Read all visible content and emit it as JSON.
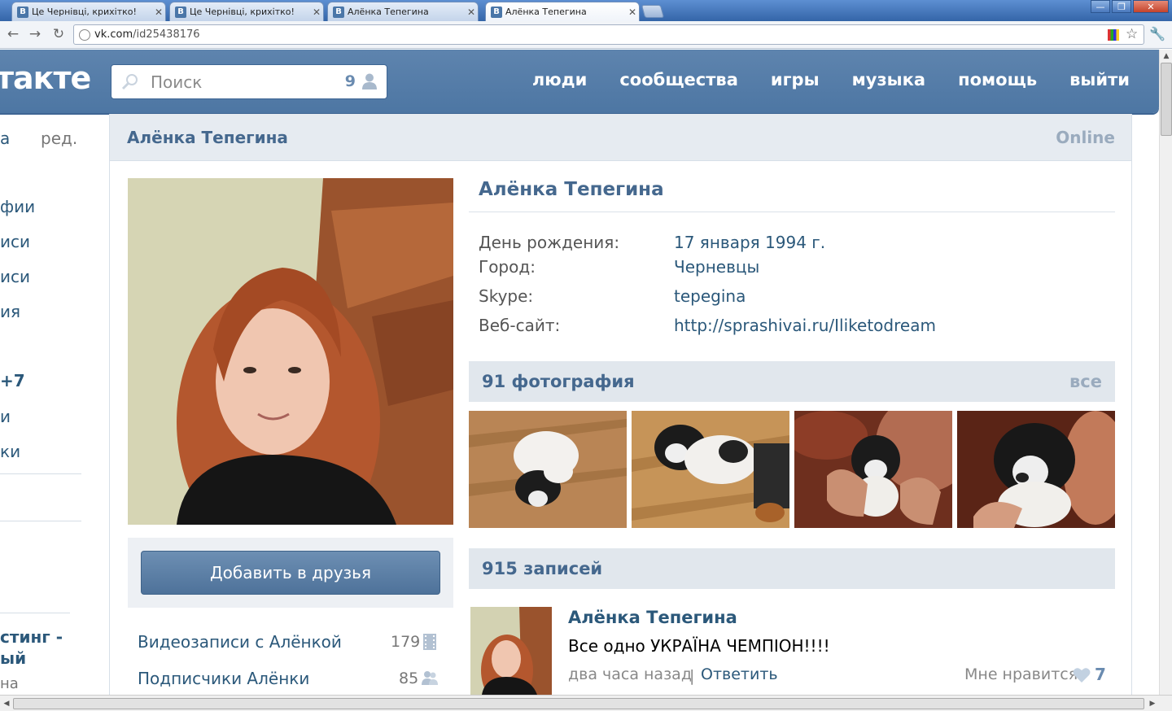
{
  "browser": {
    "tabs": [
      {
        "favicon": "В",
        "title": "Це Чернівці, крихітко!"
      },
      {
        "favicon": "В",
        "title": "Це Чернівці, крихітко!"
      },
      {
        "favicon": "В",
        "title": "Алёнка Тепегина"
      },
      {
        "favicon": "В",
        "title": "Алёнка Тепегина"
      }
    ],
    "url_host": "vk.com",
    "url_path": "/id25438176"
  },
  "header": {
    "logo": "такте",
    "search_placeholder": "Поиск",
    "search_count": "9",
    "nav": [
      "люди",
      "сообщества",
      "игры",
      "музыка",
      "помощь",
      "выйти"
    ]
  },
  "sidebar": {
    "top_left": "а",
    "edit": "ред.",
    "items": [
      "фии",
      "иси",
      "иси",
      "ия",
      "+7",
      "и",
      "ки"
    ],
    "ad_title_1": "стинг -",
    "ad_title_2": "ый",
    "ad_sub": "на"
  },
  "profile": {
    "header_name": "Алёнка Тепегина",
    "status": "Online",
    "name": "Алёнка Тепегина",
    "info": [
      {
        "label": "День рождения:",
        "value": "17 января 1994 г."
      },
      {
        "label": "Город:",
        "value": "Черневцы"
      },
      {
        "label": "Skype:",
        "value": "tepegina"
      },
      {
        "label": "Веб-сайт:",
        "value": "http://sprashivai.ru/Iliketodream"
      }
    ],
    "add_friend": "Добавить в друзья",
    "links": [
      {
        "label": "Видеозаписи с Алёнкой",
        "count": "179"
      },
      {
        "label": "Подписчики Алёнки",
        "count": "85"
      }
    ]
  },
  "photos": {
    "title": "91 фотография",
    "all": "все"
  },
  "wall": {
    "title": "915 записей",
    "post": {
      "author": "Алёнка Тепегина",
      "text": "Все одно УКРАЇНА ЧЕМПІОН!!!!",
      "time": "два часа назад",
      "divider": "|",
      "reply": "Ответить",
      "like_label": "Мне нравится",
      "like_count": "7"
    }
  },
  "colors": {
    "vk_blue": "#4d76a3",
    "link": "#2b587a",
    "heading": "#45688e",
    "muted": "#9aabbe"
  }
}
